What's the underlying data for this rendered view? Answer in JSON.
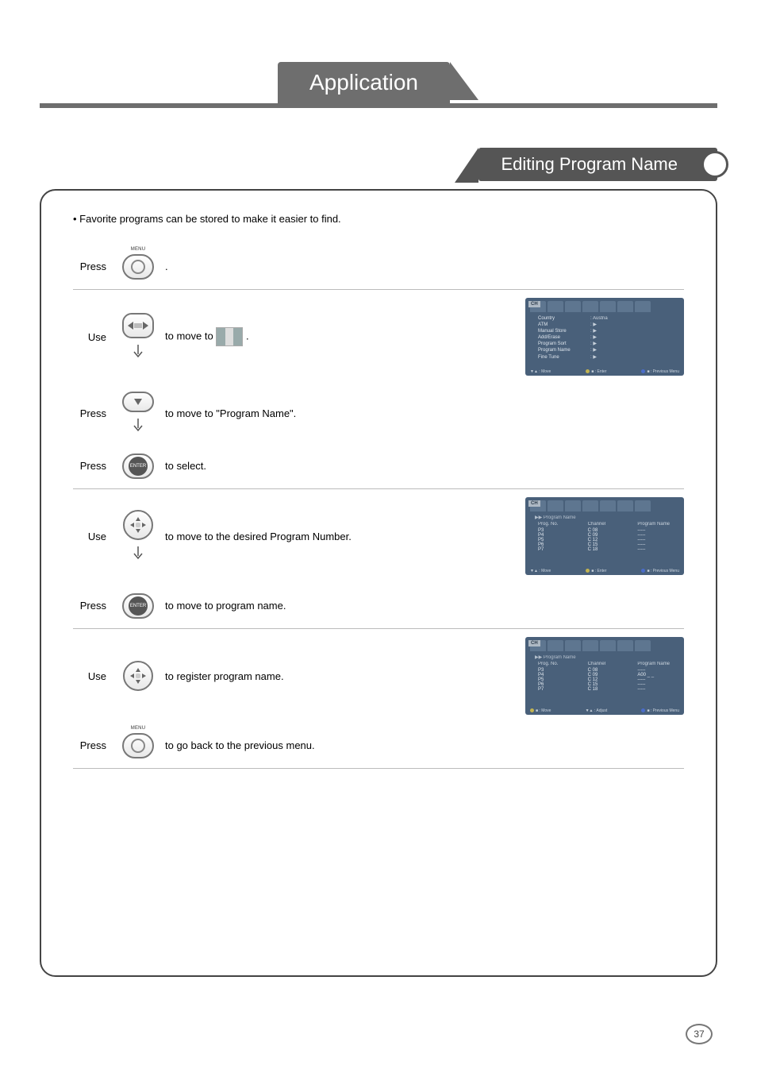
{
  "header": {
    "tab": "Application"
  },
  "section": {
    "title": "Editing Program Name"
  },
  "intro": "Favorite programs can be stored to make it easier to find.",
  "buttons": {
    "menu_label": "MENU",
    "enter_label": "ENTER"
  },
  "steps": [
    {
      "verb": "Press",
      "icon": "menu",
      "desc_prefix": "",
      "desc_suffix": ".",
      "screen": null
    },
    {
      "verb": "Use",
      "icon": "lr-then-down",
      "desc_prefix": "to move to ",
      "desc_mid_icon": "flag",
      "desc_suffix": " .",
      "screen": "osd1"
    },
    {
      "verb": "Press",
      "icon": "down-then-down",
      "desc": "to move to \"Program Name\".",
      "screen": null
    },
    {
      "verb": "Press",
      "icon": "enter",
      "desc": "to select.",
      "screen": null
    },
    {
      "verb": "Use",
      "icon": "dir4-then-down",
      "desc": "to  move to the desired Program Number.",
      "screen": "osd2"
    },
    {
      "verb": "Press",
      "icon": "enter",
      "desc": "to move to program name.",
      "screen": null
    },
    {
      "verb": "Use",
      "icon": "dir4",
      "desc": "to register program name.",
      "screen": "osd3"
    },
    {
      "verb": "Press",
      "icon": "menu",
      "desc": "to go back to the previous menu.",
      "screen": null
    }
  ],
  "osd1": {
    "badge": "CH",
    "items": [
      {
        "l": "Country",
        "r": ": Austria"
      },
      {
        "l": "ATM",
        "r": ": ▶"
      },
      {
        "l": "Manual Store",
        "r": ": ▶"
      },
      {
        "l": "Add/Erase",
        "r": ": ▶"
      },
      {
        "l": "Program Sort",
        "r": ": ▶"
      },
      {
        "l": "Program Name",
        "r": ": ▶"
      },
      {
        "l": "Fine Tune",
        "r": ": ▶"
      }
    ],
    "foot": {
      "left": "▼▲ : Move",
      "mid": "■ : Enter",
      "right": "■ : Previous Menu"
    }
  },
  "osd2": {
    "badge": "CH",
    "sub": "▶▶  Program Name",
    "headers": [
      "Prog. No.",
      "Channel",
      "Program Name"
    ],
    "rows": [
      {
        "p": "P3",
        "c": "C 08",
        "n": "-----"
      },
      {
        "p": "P4",
        "c": "C 09",
        "n": "-----"
      },
      {
        "p": "P5",
        "c": "C 12",
        "n": "-----"
      },
      {
        "p": "P6",
        "c": "C 15",
        "n": "-----"
      },
      {
        "p": "P7",
        "c": "C 18",
        "n": "-----"
      }
    ],
    "foot": {
      "left": "▼▲ : Move",
      "mid": "■ : Enter",
      "right": "■ : Previous Menu"
    }
  },
  "osd3": {
    "badge": "CH",
    "sub": "▶▶  Program Name",
    "headers": [
      "Prog. No.",
      "Channel",
      "Program Name"
    ],
    "rows": [
      {
        "p": "P3",
        "c": "C 08",
        "n": "-----"
      },
      {
        "p": "P4",
        "c": "C 09",
        "n": "A00 _ _"
      },
      {
        "p": "P5",
        "c": "C 12",
        "n": "-----"
      },
      {
        "p": "P6",
        "c": "C 15",
        "n": "-----"
      },
      {
        "p": "P7",
        "c": "C 18",
        "n": "-----"
      }
    ],
    "foot": {
      "left": "■ : Move",
      "mid": "▼▲ : Adjust",
      "right": "■ : Previous Menu"
    }
  },
  "page_number": "37"
}
